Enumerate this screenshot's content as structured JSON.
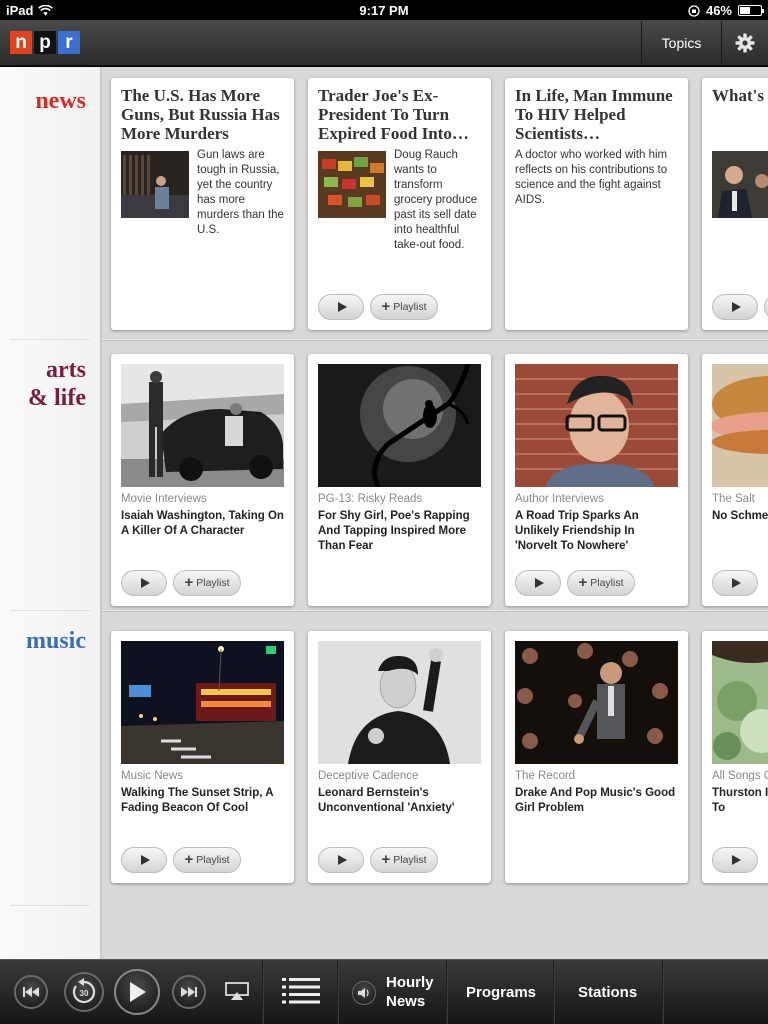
{
  "status_bar": {
    "device": "iPad",
    "time": "9:17 PM",
    "battery": "46%",
    "battery_level": 0.46
  },
  "header": {
    "topics_label": "Topics"
  },
  "sections": [
    {
      "name": "news",
      "color": "#d62d20"
    },
    {
      "name": "arts\n& life",
      "color": "#7a1b40"
    },
    {
      "name": "music",
      "color": "#3b6db5"
    }
  ],
  "news": [
    {
      "headline": "The U.S. Has More Guns, But Russia Has More Murders",
      "teaser": "Gun laws are tough in Russia, yet the country has more murders than the U.S.",
      "has_play": false
    },
    {
      "headline": "Trader Joe's Ex-President To Turn Expired Food Into…",
      "teaser": "Doug Rauch wants to transform grocery produce past its sell date into healthful take-out food.",
      "has_play": true
    },
    {
      "headline": "In Life, Man Immune To HIV Helped Scientists…",
      "teaser": "A doctor who worked with him reflects on his contributions to science and the fight against AIDS.",
      "has_play": false
    },
    {
      "headline": "What's Congre Budget",
      "teaser": "",
      "has_play": true
    }
  ],
  "arts": [
    {
      "category": "Movie Interviews",
      "title": "Isaiah Washington, Taking On A Killer Of A Character"
    },
    {
      "category": "PG-13: Risky Reads",
      "title": "For Shy Girl, Poe's Rapping And Tapping Inspired More Than Fear"
    },
    {
      "category": "Author Interviews",
      "title": "A Road Trip Sparks An Unlikely Friendship In 'Norvelt To Nowhere'"
    },
    {
      "category": "The Salt",
      "title": "No Schme History Of"
    }
  ],
  "music": [
    {
      "category": "Music News",
      "title": "Walking The Sunset Strip, A Fading Beacon Of Cool"
    },
    {
      "category": "Deceptive Cadence",
      "title": "Leonard Bernstein's Unconventional 'Anxiety'"
    },
    {
      "category": "The Record",
      "title": "Drake And Pop Music's Good Girl Problem"
    },
    {
      "category": "All Songs C",
      "title": "Thurston I Aitken Tal 'Station To"
    }
  ],
  "buttons": {
    "playlist_label": "Playlist"
  },
  "player": {
    "skip_seconds": "30",
    "hourly_news": "Hourly\nNews",
    "programs": "Programs",
    "stations": "Stations"
  }
}
